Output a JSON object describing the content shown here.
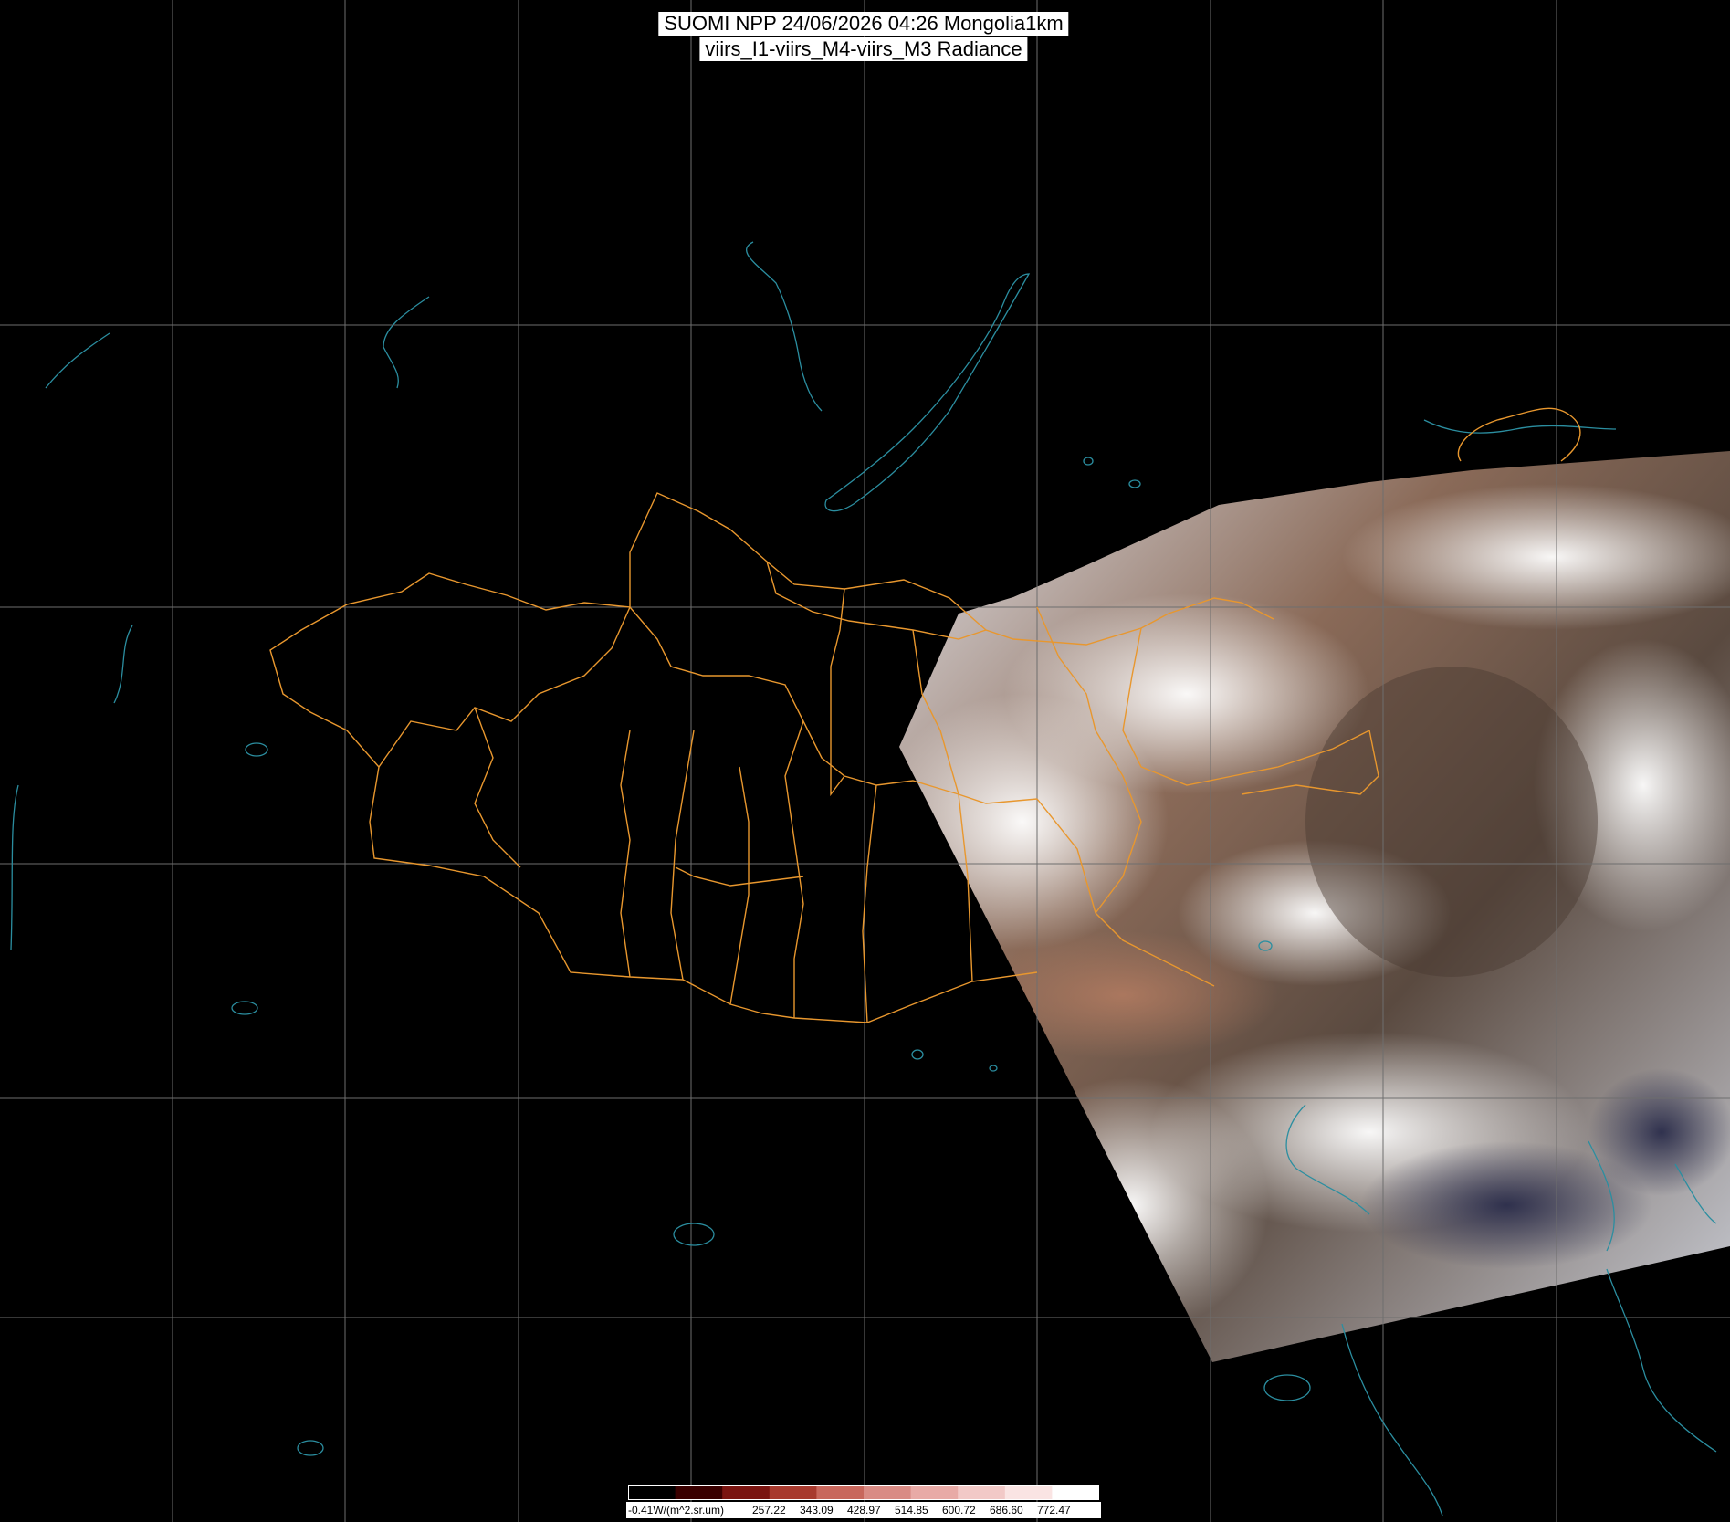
{
  "title": {
    "line1": "SUOMI NPP 24/06/2026 04:26 Mongolia1km",
    "line2": "viirs_I1-viirs_M4-viirs_M3 Radiance"
  },
  "colors": {
    "background": "#000000",
    "grid": "#6e6e6e",
    "coastline": "#2b8ea0",
    "admin_border": "#e8972e",
    "cloud": "#eef0f4",
    "land": "#6a4a3a"
  },
  "colorbar": {
    "stops": [
      "#000000",
      "#3a0000",
      "#7a1410",
      "#a83a2e",
      "#c8675c",
      "#d98b84",
      "#e8aaa6",
      "#f2c9c7",
      "#fae4e3",
      "#ffffff"
    ],
    "labels": [
      "-0.41W/(m^2.sr.um)",
      "257.22",
      "343.09",
      "428.97",
      "514.85",
      "600.72",
      "686.60",
      "772.47"
    ]
  }
}
